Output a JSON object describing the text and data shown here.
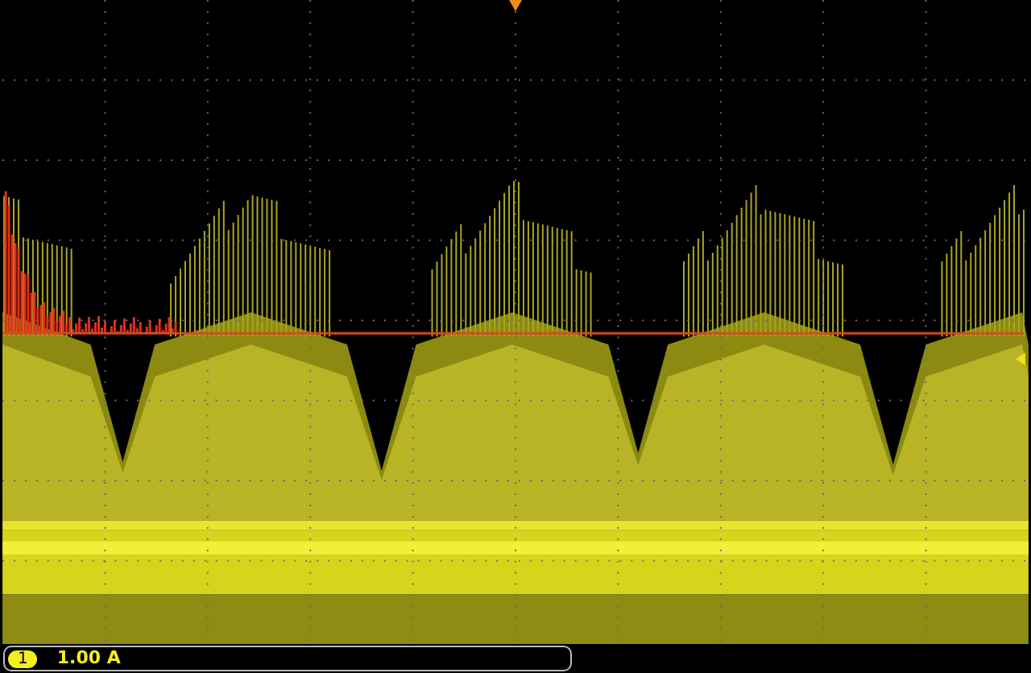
{
  "channel": {
    "number": "1",
    "scale": "1.00 A"
  }
}
